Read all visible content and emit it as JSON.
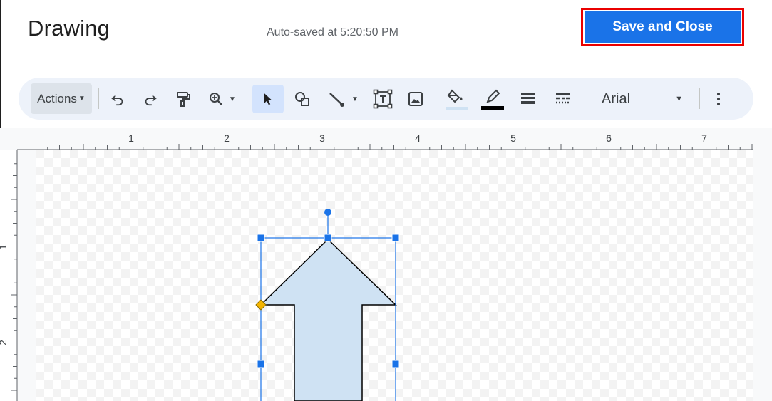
{
  "header": {
    "title": "Drawing",
    "autosave": "Auto-saved at 5:20:50 PM",
    "save_close_label": "Save and Close"
  },
  "toolbar": {
    "actions_label": "Actions",
    "font_name": "Arial"
  },
  "ruler": {
    "horizontal_labels": [
      "1",
      "2",
      "3",
      "4",
      "5",
      "6",
      "7"
    ],
    "vertical_labels": [
      "1",
      "2"
    ]
  },
  "colors": {
    "accent": "#1a73e8",
    "highlight_border": "#ea0000",
    "toolbar_bg": "#edf2fa",
    "shape_fill": "#cfe2f3",
    "selection": "#1a73e8",
    "adjust_handle": "#f4b400"
  },
  "icons": [
    "undo-icon",
    "redo-icon",
    "paint-format-icon",
    "zoom-icon",
    "select-icon",
    "shape-icon",
    "line-icon",
    "text-box-icon",
    "image-icon",
    "fill-color-icon",
    "border-color-icon",
    "border-weight-icon",
    "border-dash-icon",
    "more-vert-icon"
  ]
}
